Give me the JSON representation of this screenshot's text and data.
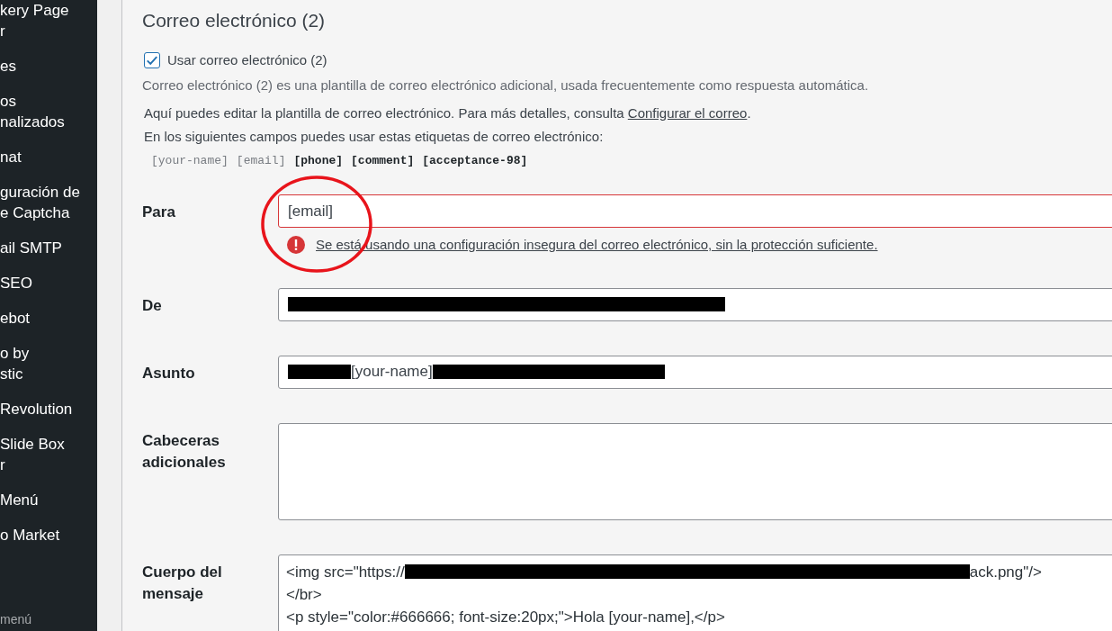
{
  "sidebar": {
    "items": [
      {
        "label": "kery Page\nr",
        "selected": false
      },
      {
        "label": "es",
        "selected": false
      },
      {
        "label": "os\nnalizados",
        "selected": false
      },
      {
        "label": "nat",
        "selected": false
      },
      {
        "label": "guración de\ne Captcha",
        "selected": false
      },
      {
        "label": "ail SMTP",
        "selected": false
      },
      {
        "label": "SEO",
        "selected": false
      },
      {
        "label": "ebot",
        "selected": false
      },
      {
        "label": "o by\nstic",
        "selected": false
      },
      {
        "label": "Revolution",
        "selected": false
      },
      {
        "label": "Slide Box\nr",
        "selected": false
      },
      {
        "label": "Menú",
        "selected": false
      },
      {
        "label": "o Market",
        "selected": false
      }
    ],
    "collapse": "menú"
  },
  "section": {
    "title": "Correo electrónico (2)",
    "use_checkbox": {
      "label": "Usar correo electrónico (2)",
      "checked": true
    },
    "description": "Correo electrónico (2) es una plantilla de correo electrónico adicional, usada frecuentemente como respuesta automática.",
    "help_line": "Aquí puedes editar la plantilla de correo electrónico. Para más detalles, consulta ",
    "help_link": "Configurar el correo",
    "help_end": ".",
    "tags_intro": "En los siguientes campos puedes usar estas etiquetas de correo electrónico:",
    "tags": [
      {
        "text": "[your-name]",
        "used": true
      },
      {
        "text": "[email]",
        "used": true
      },
      {
        "text": "[phone]",
        "used": false
      },
      {
        "text": "[comment]",
        "used": false
      },
      {
        "text": "[acceptance-98]",
        "used": false
      }
    ]
  },
  "fields": [
    {
      "kind": "input",
      "label": "Para",
      "parts": [
        {
          "text": "[email]"
        }
      ],
      "error": "Se está usando una configuración insegura del correo electrónico, sin la protección suficiente.",
      "highlighted": true
    },
    {
      "kind": "input",
      "label": "De",
      "parts": [
        {
          "kind": "redacted"
        }
      ],
      "highlighted": false
    },
    {
      "kind": "input",
      "label": "Asunto",
      "parts": [
        {
          "kind": "redacted"
        },
        {
          "text": "[your-name]"
        },
        {
          "kind": "redacted"
        }
      ],
      "highlighted": false
    },
    {
      "kind": "textarea",
      "label": "Cabeceras adicionales",
      "highlighted": false
    },
    {
      "kind": "body",
      "label": "Cuerpo del mensaje",
      "lines": [
        [
          {
            "text": "<img src=\"https://"
          },
          {
            "kind": "redacted"
          },
          {
            "text": "ack.png\"/>"
          }
        ],
        [
          {
            "text": "</br>"
          }
        ],
        [
          {
            "text": "<p style=\"color:#666666; font-size:20px;\">Hola [your-name],</p>"
          }
        ]
      ],
      "highlighted": false
    }
  ]
}
